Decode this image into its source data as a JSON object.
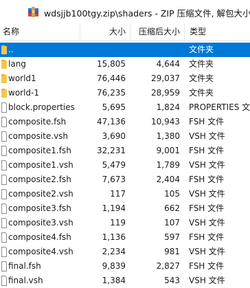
{
  "window": {
    "title": "wdsjjb100tgy.zip\\shaders - ZIP 压缩文件, 解包大小为"
  },
  "columns": {
    "name": "名称",
    "size": "大小",
    "compressed": "压缩后大小",
    "type": "类型"
  },
  "icons": {
    "app": "winrar-archive-icon",
    "folder": "folder-icon",
    "file": "file-icon"
  },
  "colors": {
    "selection": "#0078d7",
    "folder": "#f3c84a"
  },
  "rows": [
    {
      "name": "..",
      "size": "",
      "compressed": "",
      "type": "文件夹",
      "kind": "folder",
      "selected": true
    },
    {
      "name": "lang",
      "size": "15,805",
      "compressed": "4,644",
      "type": "文件夹",
      "kind": "folder"
    },
    {
      "name": "world1",
      "size": "76,446",
      "compressed": "29,037",
      "type": "文件夹",
      "kind": "folder"
    },
    {
      "name": "world-1",
      "size": "76,235",
      "compressed": "28,959",
      "type": "文件夹",
      "kind": "folder"
    },
    {
      "name": "block.properties",
      "size": "5,695",
      "compressed": "1,824",
      "type": "PROPERTIES 文",
      "kind": "file"
    },
    {
      "name": "composite.fsh",
      "size": "47,136",
      "compressed": "10,943",
      "type": "FSH 文件",
      "kind": "file"
    },
    {
      "name": "composite.vsh",
      "size": "3,690",
      "compressed": "1,380",
      "type": "VSH 文件",
      "kind": "file"
    },
    {
      "name": "composite1.fsh",
      "size": "32,231",
      "compressed": "9,001",
      "type": "FSH 文件",
      "kind": "file"
    },
    {
      "name": "composite1.vsh",
      "size": "5,479",
      "compressed": "1,789",
      "type": "VSH 文件",
      "kind": "file"
    },
    {
      "name": "composite2.fsh",
      "size": "7,673",
      "compressed": "2,404",
      "type": "FSH 文件",
      "kind": "file"
    },
    {
      "name": "composite2.vsh",
      "size": "117",
      "compressed": "105",
      "type": "VSH 文件",
      "kind": "file"
    },
    {
      "name": "composite3.fsh",
      "size": "1,194",
      "compressed": "662",
      "type": "FSH 文件",
      "kind": "file"
    },
    {
      "name": "composite3.vsh",
      "size": "119",
      "compressed": "107",
      "type": "VSH 文件",
      "kind": "file"
    },
    {
      "name": "composite4.fsh",
      "size": "1,136",
      "compressed": "597",
      "type": "FSH 文件",
      "kind": "file"
    },
    {
      "name": "composite4.vsh",
      "size": "2,234",
      "compressed": "981",
      "type": "VSH 文件",
      "kind": "file"
    },
    {
      "name": "final.fsh",
      "size": "9,839",
      "compressed": "2,827",
      "type": "FSH 文件",
      "kind": "file"
    },
    {
      "name": "final.vsh",
      "size": "1,384",
      "compressed": "543",
      "type": "VSH 文件",
      "kind": "file"
    }
  ]
}
